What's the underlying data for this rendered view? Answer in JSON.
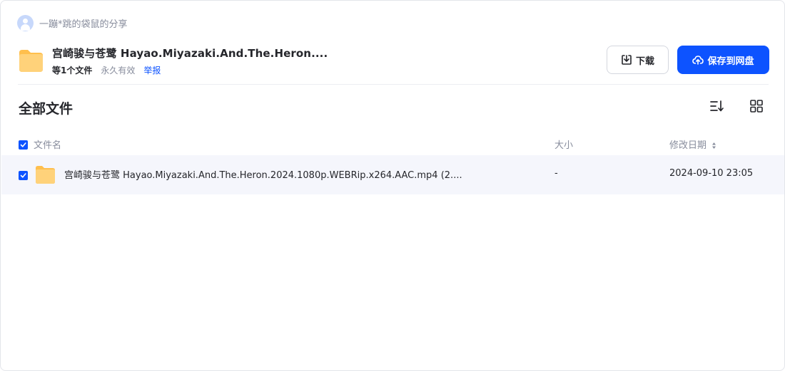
{
  "sharer": {
    "name": "一蹦*跳的袋鼠的分享"
  },
  "share": {
    "title": "宫崎骏与苍鹭 Hayao.Miyazaki.And.The.Heron....",
    "file_count": "等1个文件",
    "validity": "永久有效",
    "report_label": "举报"
  },
  "actions": {
    "download_label": "下载",
    "save_label": "保存到网盘"
  },
  "files_section": {
    "title": "全部文件",
    "columns": {
      "name": "文件名",
      "size": "大小",
      "modified": "修改日期"
    },
    "rows": [
      {
        "name": "宫崎骏与苍鹭 Hayao.Miyazaki.And.The.Heron.2024.1080p.WEBRip.x264.AAC.mp4 (2....",
        "size": "-",
        "modified": "2024-09-10 23:05",
        "checked": true
      }
    ]
  },
  "colors": {
    "accent": "#0d53ff",
    "folder": "#ffcc66",
    "row_highlight": "#f5f6fc",
    "muted_text": "#878c9c"
  },
  "icons": [
    "user-avatar-icon",
    "folder-icon",
    "download-icon",
    "cloud-upload-icon",
    "sort-list-icon",
    "grid-view-icon",
    "checkbox-checked-icon",
    "sort-caret-icon"
  ]
}
